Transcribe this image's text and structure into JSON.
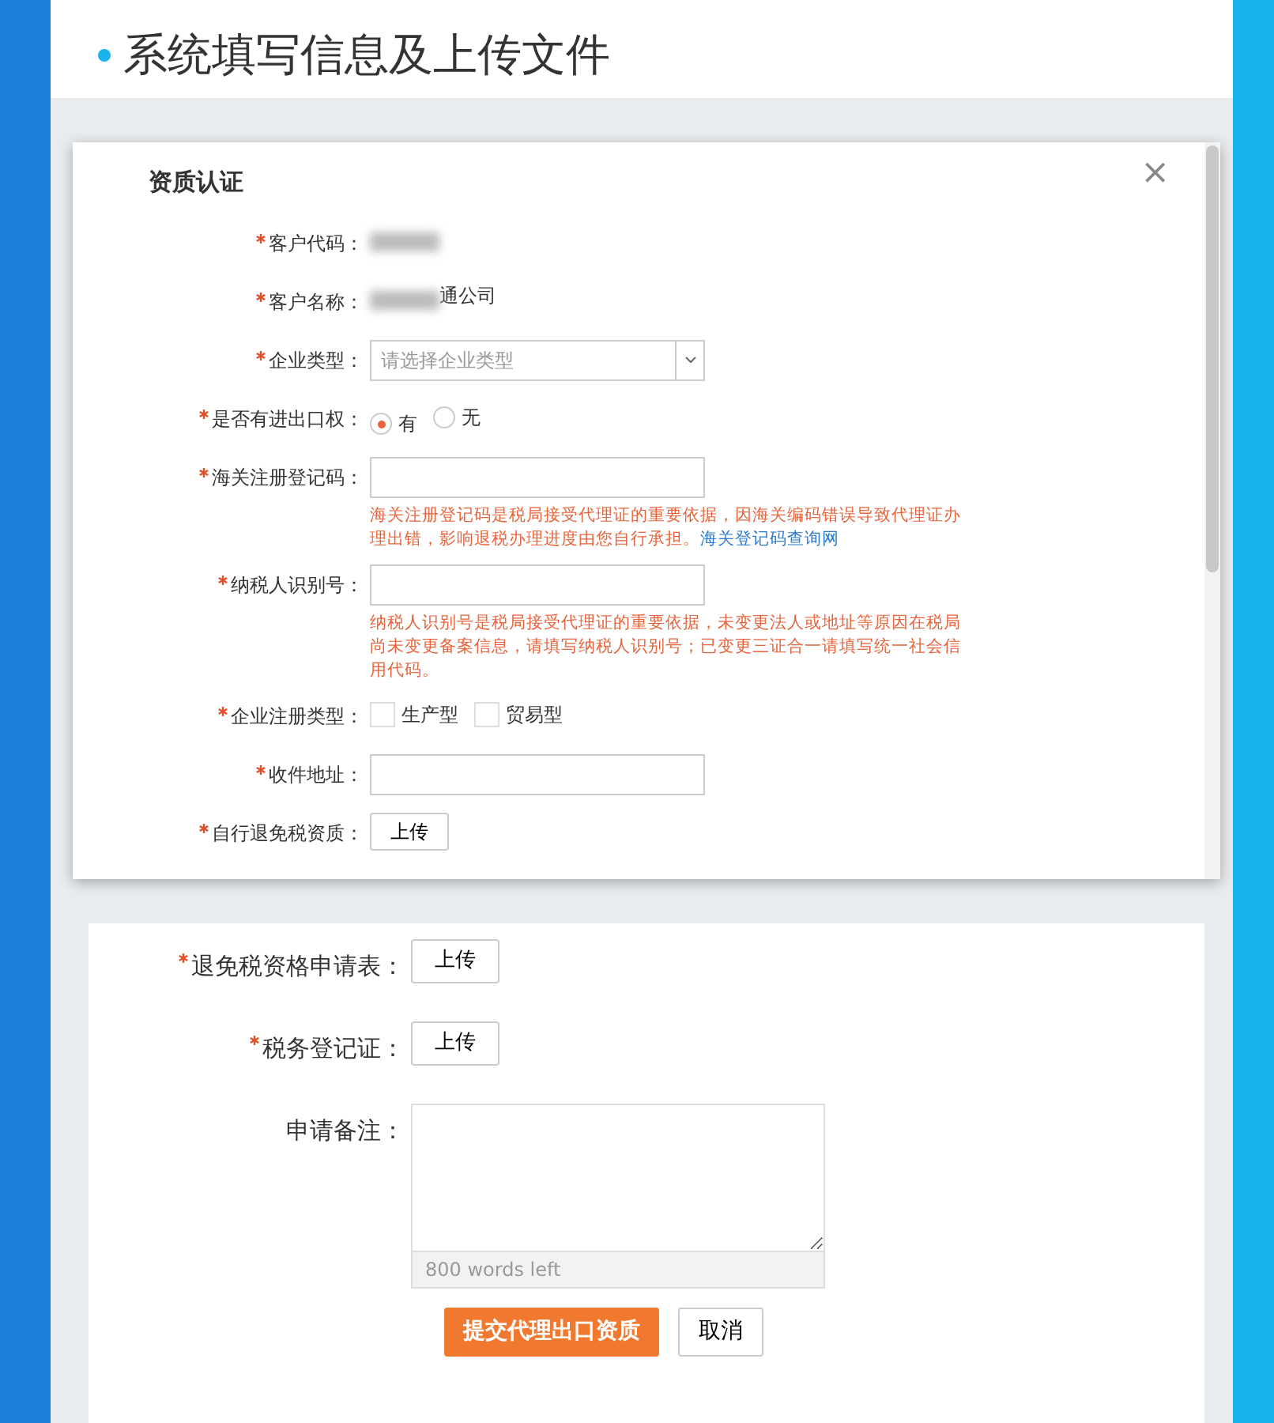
{
  "slide_title": "系统填写信息及上传文件",
  "modal": {
    "title": "资质认证",
    "close": "×",
    "fields": [
      {
        "kind": "blurred",
        "label": "客户代码：",
        "required": true
      },
      {
        "kind": "blurred_text",
        "label": "客户名称：",
        "required": true,
        "value": "通公司"
      },
      {
        "kind": "select",
        "label": "企业类型：",
        "required": true,
        "placeholder": "请选择企业类型"
      },
      {
        "kind": "radio",
        "label": "是否有进出口权：",
        "required": true,
        "options": [
          {
            "label": "有",
            "selected": true
          },
          {
            "label": "无",
            "selected": false
          }
        ]
      },
      {
        "kind": "input",
        "label": "海关注册登记码：",
        "required": true,
        "help": "海关注册登记码是税局接受代理证的重要依据，因海关编码错误导致代理证办理出错，影响退税办理进度由您自行承担。",
        "link": "海关登记码查询网"
      },
      {
        "kind": "input",
        "label": "纳税人识别号：",
        "required": true,
        "help": "纳税人识别号是税局接受代理证的重要依据，未变更法人或地址等原因在税局尚未变更备案信息，请填写纳税人识别号；已变更三证合一请填写统一社会信用代码。"
      },
      {
        "kind": "checkbox",
        "label": "企业注册类型：",
        "required": true,
        "options": [
          {
            "label": "生产型",
            "checked": false
          },
          {
            "label": "贸易型",
            "checked": false
          }
        ]
      },
      {
        "kind": "input",
        "label": "收件地址：",
        "required": true
      },
      {
        "kind": "upload",
        "label": "自行退免税资质：",
        "required": true,
        "button": "上传"
      }
    ]
  },
  "form": {
    "fields": [
      {
        "kind": "upload",
        "label": "退免税资格申请表：",
        "required": true,
        "button": "上传"
      },
      {
        "kind": "upload",
        "label": "税务登记证：",
        "required": true,
        "button": "上传"
      },
      {
        "kind": "textarea",
        "label": "申请备注：",
        "required": false,
        "counter": "800 words left"
      }
    ],
    "submit": "提交代理出口资质",
    "cancel": "取消"
  }
}
